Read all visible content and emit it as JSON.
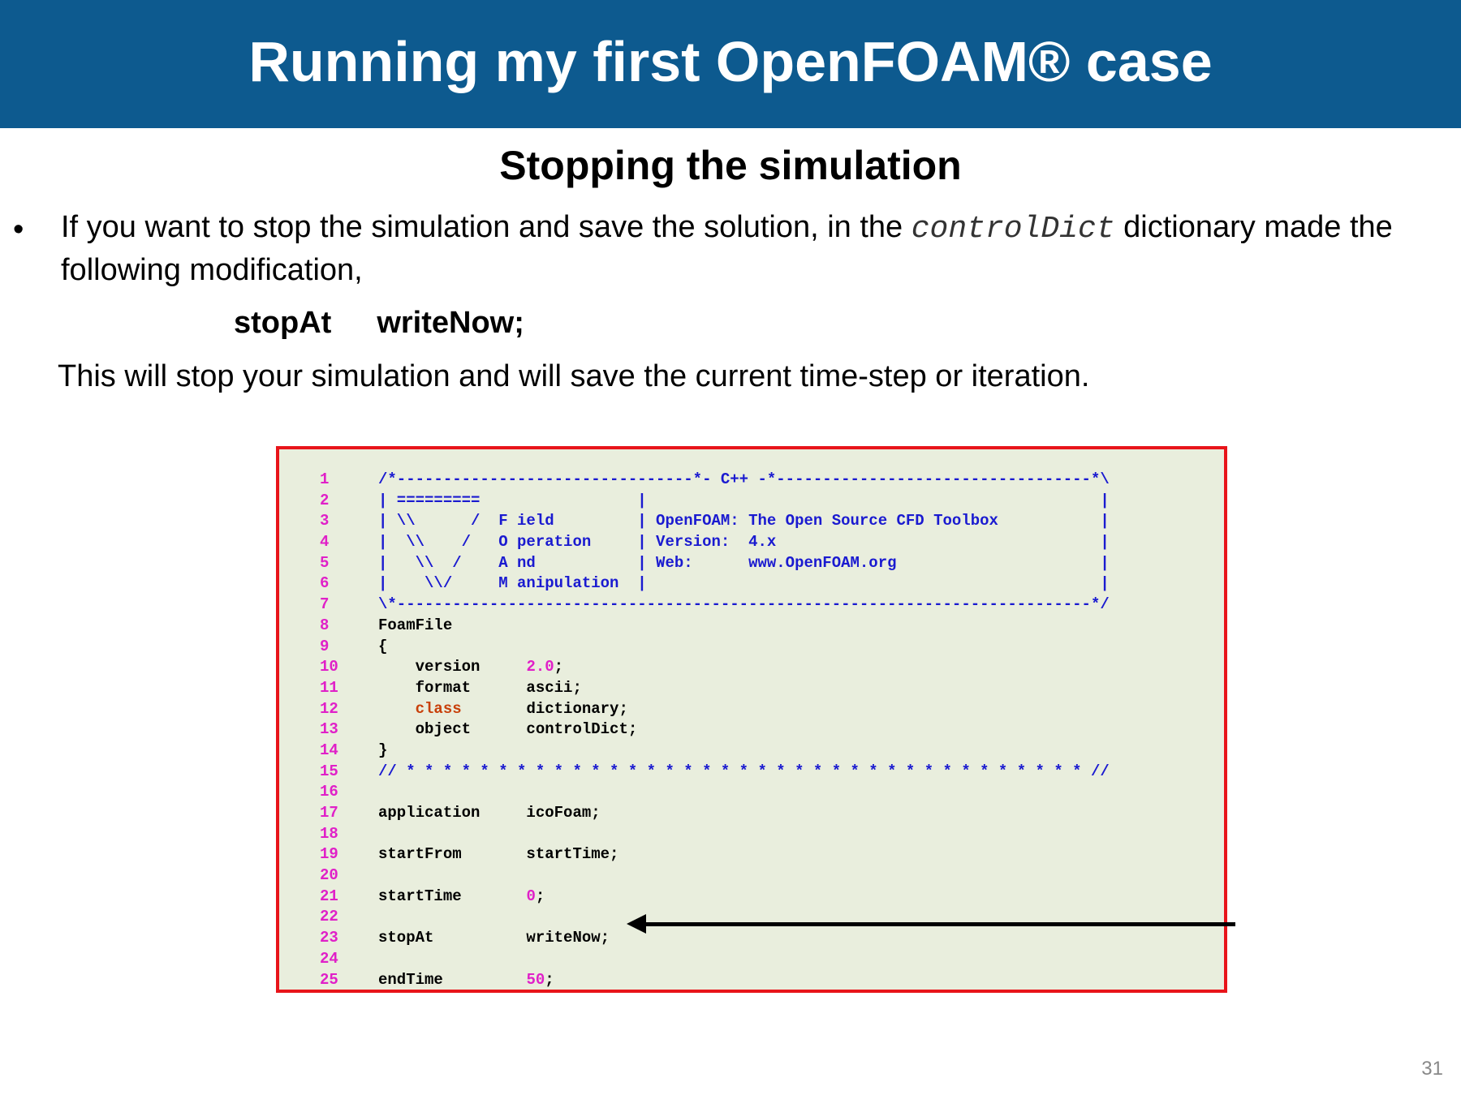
{
  "header": {
    "title": "Running my first OpenFOAM® case"
  },
  "subtitle": "Stopping the simulation",
  "bullet": {
    "marker": "•",
    "text_before": "If you want to stop the simulation and save the solution, in the ",
    "code_word": "controlDict",
    "text_after": " dictionary made the following modification,"
  },
  "stop_line": {
    "keyword": "stopAt",
    "value": "writeNow;"
  },
  "note": "This will stop your simulation and will save the current time-step or iteration.",
  "code": [
    {
      "n": "1",
      "parts": [
        {
          "t": "/*--------------------------------*- C++ -*----------------------------------*\\",
          "c": "blue"
        }
      ]
    },
    {
      "n": "2",
      "parts": [
        {
          "t": "| =========                 |                                                 |",
          "c": "blue"
        }
      ]
    },
    {
      "n": "3",
      "parts": [
        {
          "t": "| \\\\      /  F ield         | OpenFOAM: The Open Source CFD Toolbox           |",
          "c": "blue"
        }
      ]
    },
    {
      "n": "4",
      "parts": [
        {
          "t": "|  \\\\    /   O peration     | Version:  4.x                                   |",
          "c": "blue"
        }
      ]
    },
    {
      "n": "5",
      "parts": [
        {
          "t": "|   \\\\  /    A nd           | Web:      www.OpenFOAM.org                      |",
          "c": "blue"
        }
      ]
    },
    {
      "n": "6",
      "parts": [
        {
          "t": "|    \\\\/     M anipulation  |                                                 |",
          "c": "blue"
        }
      ]
    },
    {
      "n": "7",
      "parts": [
        {
          "t": "\\*---------------------------------------------------------------------------*/",
          "c": "blue"
        }
      ]
    },
    {
      "n": "8",
      "parts": [
        {
          "t": "FoamFile",
          "c": "black"
        }
      ]
    },
    {
      "n": "9",
      "parts": [
        {
          "t": "{",
          "c": "black"
        }
      ]
    },
    {
      "n": "10",
      "parts": [
        {
          "t": "    version     ",
          "c": "black"
        },
        {
          "t": "2.0",
          "c": "mag"
        },
        {
          "t": ";",
          "c": "black"
        }
      ]
    },
    {
      "n": "11",
      "parts": [
        {
          "t": "    format      ascii;",
          "c": "black"
        }
      ]
    },
    {
      "n": "12",
      "parts": [
        {
          "t": "    ",
          "c": "black"
        },
        {
          "t": "class",
          "c": "orange"
        },
        {
          "t": "       dictionary;",
          "c": "black"
        }
      ]
    },
    {
      "n": "13",
      "parts": [
        {
          "t": "    object      controlDict;",
          "c": "black"
        }
      ]
    },
    {
      "n": "14",
      "parts": [
        {
          "t": "}",
          "c": "black"
        }
      ]
    },
    {
      "n": "15",
      "parts": [
        {
          "t": "// * * * * * * * * * * * * * * * * * * * * * * * * * * * * * * * * * * * * * //",
          "c": "blue"
        }
      ]
    },
    {
      "n": "16",
      "parts": [
        {
          "t": "",
          "c": "black"
        }
      ]
    },
    {
      "n": "17",
      "parts": [
        {
          "t": "application     icoFoam;",
          "c": "black"
        }
      ]
    },
    {
      "n": "18",
      "parts": [
        {
          "t": "",
          "c": "black"
        }
      ]
    },
    {
      "n": "19",
      "parts": [
        {
          "t": "startFrom       startTime;",
          "c": "black"
        }
      ]
    },
    {
      "n": "20",
      "parts": [
        {
          "t": "",
          "c": "black"
        }
      ]
    },
    {
      "n": "21",
      "parts": [
        {
          "t": "startTime       ",
          "c": "black"
        },
        {
          "t": "0",
          "c": "mag"
        },
        {
          "t": ";",
          "c": "black"
        }
      ]
    },
    {
      "n": "22",
      "parts": [
        {
          "t": "",
          "c": "black"
        }
      ]
    },
    {
      "n": "23",
      "parts": [
        {
          "t": "stopAt          writeNow;",
          "c": "black"
        }
      ]
    },
    {
      "n": "24",
      "parts": [
        {
          "t": "",
          "c": "black"
        }
      ]
    },
    {
      "n": "25",
      "parts": [
        {
          "t": "endTime         ",
          "c": "black"
        },
        {
          "t": "50",
          "c": "mag"
        },
        {
          "t": ";",
          "c": "black"
        }
      ]
    }
  ],
  "page_number": "31"
}
